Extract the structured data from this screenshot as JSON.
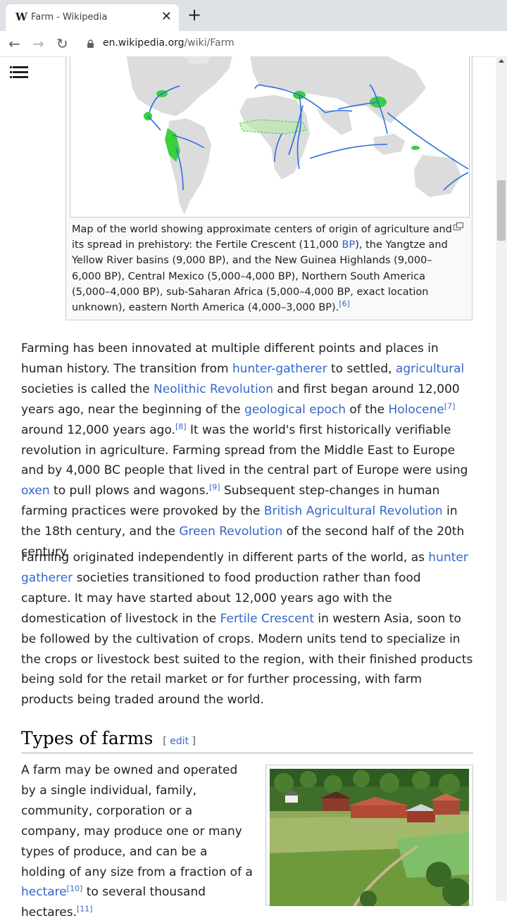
{
  "browser": {
    "tab_favicon": "W",
    "tab_title": "Farm - Wikipedia",
    "tab_close": "✕",
    "new_tab": "+",
    "back": "←",
    "forward": "→",
    "reload": "↻",
    "url_host": "en.wikipedia.org",
    "url_path": "/wiki/Farm"
  },
  "figure": {
    "caption": {
      "t1": "Map of the world showing approximate centers of origin of agriculture and its spread in prehistory: the Fertile Crescent (11,000 ",
      "bp_link": "BP",
      "t2": "), the Yangtze and Yellow River basins (9,000 BP), and the New Guinea Highlands (9,000–6,000 BP), Central Mexico (5,000–4,000 BP), Northern South America (5,000–4,000 BP), sub-Saharan Africa (5,000–4,000 BP, exact location unknown), eastern North America (4,000–3,000 BP).",
      "ref": "[6]"
    }
  },
  "para1": {
    "t1": "Farming has been innovated at multiple different points and places in human history. The transition from ",
    "l1": "hunter-gatherer",
    "t2": " to settled, ",
    "l2": "agricultural",
    "t3": " societies is called the ",
    "l3": "Neolithic Revolution",
    "t4": " and first began around 12,000 years ago, near the beginning of the ",
    "l4": "geological epoch",
    "t5": " of the ",
    "l5": "Holocene",
    "r1": "[7]",
    "t6": " around 12,000 years ago.",
    "r2": "[8]",
    "t7": " It was the world's first historically verifiable revolution in agriculture. Farming spread from the Middle East to Europe and by 4,000 BC people that lived in the central part of Europe were using ",
    "l6": "oxen",
    "t8": " to pull plows and wagons.",
    "r3": "[9]",
    "t9": " Subsequent step-changes in human farming practices were provoked by the ",
    "l7": "British Agricultural Revolution",
    "t10": " in the 18th century, and the ",
    "l8": "Green Revolution",
    "t11": " of the second half of the 20th century."
  },
  "para2": {
    "t1": "Farming originated independently in different parts of the world, as ",
    "l1": "hunter gatherer",
    "t2": " societies transitioned to food production rather than food capture. It may have started about 12,000 years ago with the domestication of livestock in the ",
    "l2": "Fertile Crescent",
    "t3": " in western Asia, soon to be followed by the cultivation of crops. Modern units tend to specialize in the crops or livestock best suited to the region, with their finished products being sold for the retail market or for further processing, with farm products being traded around the world."
  },
  "section": {
    "title": "Types of farms",
    "edit_open": "[ ",
    "edit": "edit",
    "edit_close": " ]"
  },
  "para3": {
    "t1": "A farm may be owned and operated by a single individual, family, community, corporation or a company, may produce one or many types of produce, and can be a holding of any size from a fraction of a ",
    "l1": "hectare",
    "r1": "[10]",
    "t2": " to several thousand hectares.",
    "r2": "[11]"
  },
  "icons": {
    "menu": "hamburger-menu-icon",
    "lock": "lock-icon",
    "magnify": "magnify-icon"
  },
  "colors": {
    "link": "#3366cc",
    "text": "#202122",
    "origin_green": "#3ad13a",
    "arrow_blue": "#2a6fe0"
  }
}
